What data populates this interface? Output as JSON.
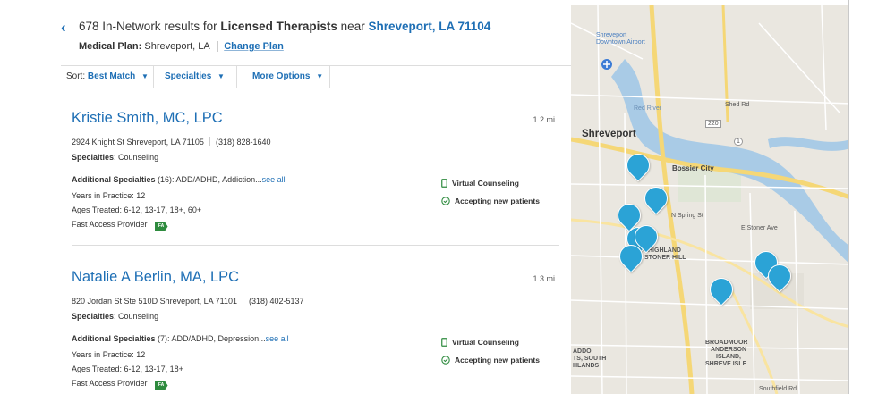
{
  "header": {
    "back_icon": "‹",
    "results_count": "678",
    "results_mid": "In-Network results for",
    "specialty": "Licensed Therapists",
    "near_word": "near",
    "location": "Shreveport, LA 71104",
    "plan_label": "Medical Plan:",
    "plan_value": "Shreveport, LA",
    "change_plan": "Change Plan"
  },
  "sortbar": {
    "sort_label": "Sort:",
    "sort_value": "Best Match",
    "specialties": "Specialties",
    "more_options": "More Options"
  },
  "providers": [
    {
      "name": "Kristie Smith, MC, LPC",
      "distance": "1.2 mi",
      "address": "2924 Knight St Shreveport, LA 71105",
      "phone": "(318) 828-1640",
      "spec_label": "Specialties",
      "specialties": "Counseling",
      "add_label": "Additional Specialties",
      "add_text": "(16): ADD/ADHD, Addiction...",
      "see_all": "see all",
      "years": "Years in Practice: 12",
      "ages": "Ages Treated: 6-12, 13-17, 18+, 60+",
      "fast_access": "Fast Access Provider",
      "badge": "FA",
      "virtual": "Virtual Counseling",
      "accepting": "Accepting new patients"
    },
    {
      "name": "Natalie A Berlin, MA, LPC",
      "distance": "1.3 mi",
      "address": "820 Jordan St Ste 510D Shreveport, LA 71101",
      "phone": "(318) 402-5137",
      "spec_label": "Specialties",
      "specialties": "Counseling",
      "add_label": "Additional Specialties",
      "add_text": "(7): ADD/ADHD, Depression...",
      "see_all": "see all",
      "years": "Years in Practice: 12",
      "ages": "Ages Treated: 6-12, 13-17, 18+",
      "fast_access": "Fast Access Provider",
      "badge": "FA",
      "virtual": "Virtual Counseling",
      "accepting": "Accepting new patients"
    }
  ],
  "map": {
    "airport": "Shreveport Downtown Airport",
    "city": "Shreveport",
    "bossier": "Bossier City",
    "red_river": "Red River",
    "highland": "HIGHLAND",
    "stoner_hill": "STONER HILL",
    "broadmoor": "BROADMOOR",
    "anderson": "ANDERSON",
    "island": "ISLAND,",
    "shreve_isle": "SHREVE ISLE",
    "south_highlands": "TS, SOUTH",
    "south_highlands2": "HLANDS",
    "addo": "ADDO",
    "road_220": "220",
    "road_1": "1",
    "shed_rd": "Shed Rd",
    "n_spring": "N Spring St",
    "southfield": "Southfield Rd",
    "e_stoner": "E Stoner Ave"
  },
  "colors": {
    "link": "#1e6fb5",
    "pin": "#2ba3d6",
    "badge": "#2e8b3e",
    "river": "#a9cbe6",
    "map_bg": "#e9e6df"
  }
}
